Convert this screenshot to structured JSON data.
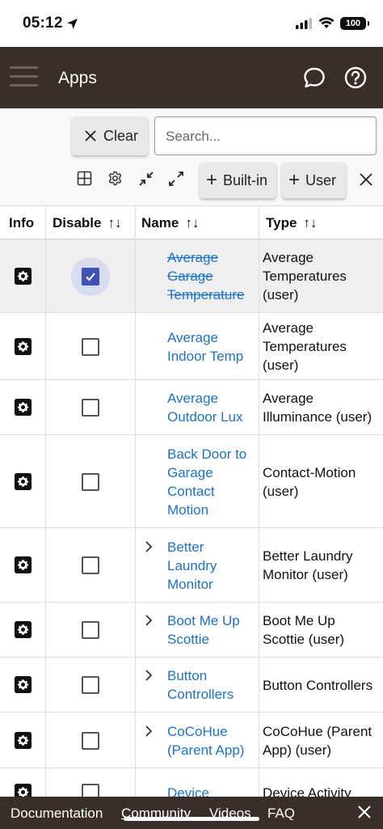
{
  "status_bar": {
    "time": "05:12",
    "battery": "100"
  },
  "header": {
    "title": "Apps"
  },
  "toolbar": {
    "clear_label": "Clear",
    "search_placeholder": "Search...",
    "builtin_label": "Built-in",
    "user_label": "User"
  },
  "table": {
    "columns": {
      "info": "Info",
      "disable": "Disable",
      "name": "Name",
      "type": "Type"
    },
    "rows": [
      {
        "name": [
          "Average",
          "Garage",
          "Temperature"
        ],
        "type": [
          "Average",
          "Temperatures",
          "(user)"
        ],
        "disabled": true,
        "expandable": false
      },
      {
        "name": [
          "Average",
          "Indoor Temp"
        ],
        "type": [
          "Average",
          "Temperatures",
          "(user)"
        ],
        "disabled": false,
        "expandable": false
      },
      {
        "name": [
          "Average",
          "Outdoor Lux"
        ],
        "type": [
          "Average",
          "Illuminance (user)"
        ],
        "disabled": false,
        "expandable": false
      },
      {
        "name": [
          "Back Door to",
          "Garage",
          "Contact",
          "Motion"
        ],
        "type": [
          "Contact-Motion",
          "(user)"
        ],
        "disabled": false,
        "expandable": false
      },
      {
        "name": [
          "Better",
          "Laundry",
          "Monitor"
        ],
        "type": [
          "Better Laundry",
          "Monitor (user)"
        ],
        "disabled": false,
        "expandable": true
      },
      {
        "name": [
          "Boot Me Up",
          "Scottie"
        ],
        "type": [
          "Boot Me Up",
          "Scottie (user)"
        ],
        "disabled": false,
        "expandable": true
      },
      {
        "name": [
          "Button",
          "Controllers"
        ],
        "type": [
          "Button Controllers"
        ],
        "disabled": false,
        "expandable": true
      },
      {
        "name": [
          "CoCoHue",
          "(Parent App)"
        ],
        "type": [
          "CoCoHue (Parent",
          "App) (user)"
        ],
        "disabled": false,
        "expandable": true
      },
      {
        "name": [
          "Device"
        ],
        "type": [
          "Device Activity"
        ],
        "disabled": false,
        "expandable": false
      }
    ]
  },
  "footer": {
    "documentation": "Documentation",
    "community": "Community",
    "videos": "Videos",
    "faq": "FAQ"
  },
  "colors": {
    "header_bg": "#3a2e2a",
    "link": "#1a73c8",
    "checkbox_checked": "#3f51b5"
  }
}
